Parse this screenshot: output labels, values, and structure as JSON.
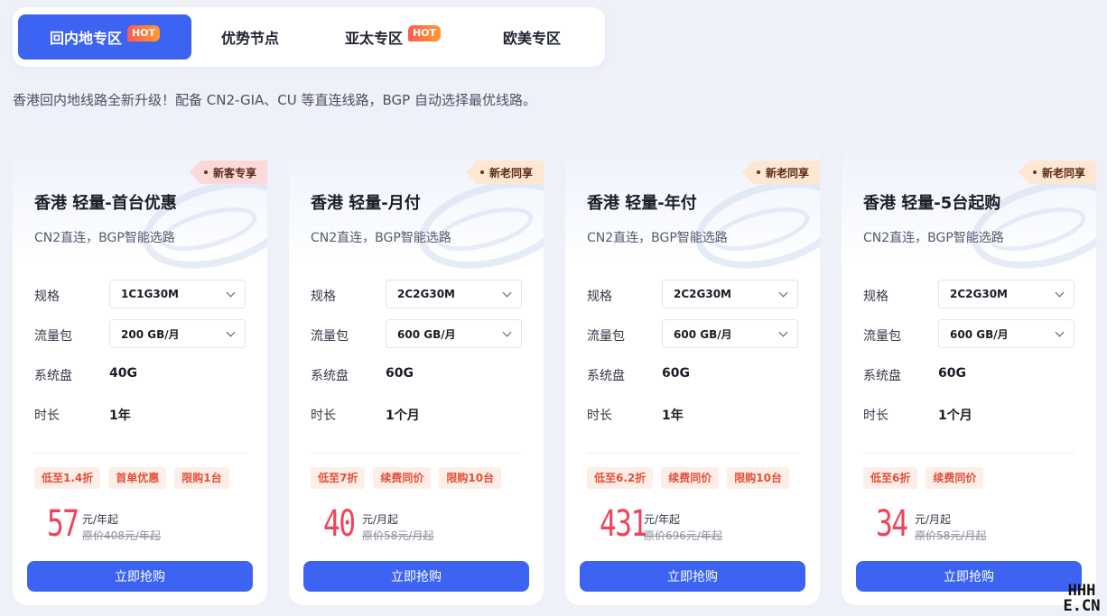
{
  "tabs": [
    {
      "label": "回内地专区",
      "hot": "HOT",
      "active": true
    },
    {
      "label": "优势节点",
      "hot": "",
      "active": false
    },
    {
      "label": "亚太专区",
      "hot": "HOT",
      "active": false
    },
    {
      "label": "欧美专区",
      "hot": "",
      "active": false
    }
  ],
  "description": "香港回内地线路全新升级！配备 CN2-GIA、CU 等直连线路，BGP 自动选择最优线路。",
  "row_labels": {
    "spec": "规格",
    "traffic": "流量包",
    "disk": "系统盘",
    "duration": "时长"
  },
  "cards": [
    {
      "tag": "新客专享",
      "tag_type": "new",
      "title": "香港 轻量-首台优惠",
      "subtitle": "CN2直连，BGP智能选路",
      "spec": "1C1G30M",
      "traffic": "200 GB/月",
      "disk": "40G",
      "duration": "1年",
      "chips": [
        "低至1.4折",
        "首单优惠",
        "限购1台"
      ],
      "price": "57",
      "unit": "元/年起",
      "original": "原价408元/年起",
      "button": "立即抢购"
    },
    {
      "tag": "新老同享",
      "tag_type": "old",
      "title": "香港 轻量-月付",
      "subtitle": "CN2直连，BGP智能选路",
      "spec": "2C2G30M",
      "traffic": "600 GB/月",
      "disk": "60G",
      "duration": "1个月",
      "chips": [
        "低至7折",
        "续费同价",
        "限购10台"
      ],
      "price": "40",
      "unit": "元/月起",
      "original": "原价58元/月起",
      "button": "立即抢购"
    },
    {
      "tag": "新老同享",
      "tag_type": "old",
      "title": "香港 轻量-年付",
      "subtitle": "CN2直连，BGP智能选路",
      "spec": "2C2G30M",
      "traffic": "600 GB/月",
      "disk": "60G",
      "duration": "1年",
      "chips": [
        "低至6.2折",
        "续费同价",
        "限购10台"
      ],
      "price": "431",
      "unit": "元/年起",
      "original": "原价696元/年起",
      "button": "立即抢购"
    },
    {
      "tag": "新老同享",
      "tag_type": "old",
      "title": "香港 轻量-5台起购",
      "subtitle": "CN2直连，BGP智能选路",
      "spec": "2C2G30M",
      "traffic": "600 GB/月",
      "disk": "60G",
      "duration": "1个月",
      "chips": [
        "低至6折",
        "续费同价"
      ],
      "price": "34",
      "unit": "元/月起",
      "original": "原价58元/月起",
      "button": "立即抢购"
    }
  ],
  "watermark": {
    "line1": "HHH",
    "line2": "E.CN"
  }
}
